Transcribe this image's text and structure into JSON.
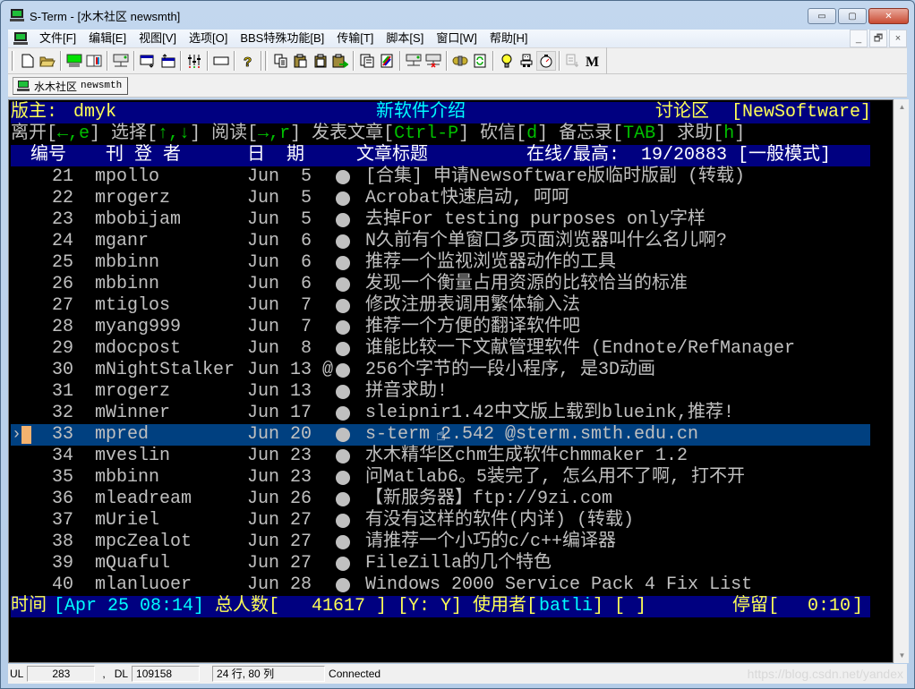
{
  "window": {
    "title": "S-Term - [水木社区 newsmth]",
    "controls": {
      "minimize": "▭",
      "maximize": "▢",
      "close": "✕"
    }
  },
  "menu": {
    "items": [
      "文件[F]",
      "编辑[E]",
      "视图[V]",
      "选项[O]",
      "BBS特殊功能[B]",
      "传输[T]",
      "脚本[S]",
      "窗口[W]",
      "帮助[H]"
    ],
    "mdi_controls": {
      "minimize": "_",
      "restore": "🗗",
      "close": "×"
    }
  },
  "toolbar": {
    "buttons": [
      {
        "name": "new-icon",
        "glyph": "🗋"
      },
      {
        "name": "open-folder-icon",
        "glyph": "📂"
      },
      {
        "name": "connect-terminal-icon",
        "glyph": "🖥"
      },
      {
        "name": "address-book-icon",
        "glyph": "📖"
      },
      {
        "name": "network-icon",
        "glyph": "🖧"
      },
      {
        "name": "window-send-icon",
        "glyph": "⧉"
      },
      {
        "name": "window-receive-icon",
        "glyph": "⧈"
      },
      {
        "name": "equalizer-icon",
        "glyph": "🎚"
      },
      {
        "name": "fullscreen-icon",
        "glyph": "▭"
      },
      {
        "name": "help-icon",
        "glyph": "?"
      },
      {
        "name": "copy-icon",
        "glyph": "⎘"
      },
      {
        "name": "paste-icon",
        "glyph": "📋"
      },
      {
        "name": "clipboard-icon",
        "glyph": "📋"
      },
      {
        "name": "paste-send-icon",
        "glyph": "📋"
      },
      {
        "name": "copy-document-icon",
        "glyph": "🗐"
      },
      {
        "name": "color-icon",
        "glyph": "🎨"
      },
      {
        "name": "connect-icon",
        "glyph": "🖧"
      },
      {
        "name": "disconnect-icon",
        "glyph": "🖧"
      },
      {
        "name": "plugin-icon",
        "glyph": "✿"
      },
      {
        "name": "refresh-icon",
        "glyph": "♻"
      },
      {
        "name": "tip-bulb-icon",
        "glyph": "💡"
      },
      {
        "name": "robot-icon",
        "glyph": "🤖"
      },
      {
        "name": "timer-icon",
        "glyph": "⏱"
      },
      {
        "name": "copy-disabled-icon",
        "glyph": "⎘"
      },
      {
        "name": "macro-icon",
        "glyph": "M"
      }
    ]
  },
  "tab": {
    "label": "水木社区",
    "host": "newsmth"
  },
  "terminal": {
    "header": {
      "moderator_label": "版主: ",
      "moderator": "dmyk",
      "board_title": "新软件介绍",
      "zone_label": "讨论区 ",
      "board_name": "[NewSoftware]"
    },
    "help_line": [
      {
        "t": "离开",
        "c": "grey"
      },
      {
        "t": "[",
        "c": "grey"
      },
      {
        "t": "←,e",
        "c": "green"
      },
      {
        "t": "] 选择[",
        "c": "grey"
      },
      {
        "t": "↑,↓",
        "c": "green"
      },
      {
        "t": "] 阅读[",
        "c": "grey"
      },
      {
        "t": "→,r",
        "c": "green"
      },
      {
        "t": "] 发表文章[",
        "c": "grey"
      },
      {
        "t": "Ctrl-P",
        "c": "green"
      },
      {
        "t": "] 砍信[",
        "c": "grey"
      },
      {
        "t": "d",
        "c": "green"
      },
      {
        "t": "] 备忘录[",
        "c": "grey"
      },
      {
        "t": "TAB",
        "c": "green"
      },
      {
        "t": "] 求助[",
        "c": "grey"
      },
      {
        "t": "h",
        "c": "green"
      },
      {
        "t": "]",
        "c": "grey"
      }
    ],
    "columns": {
      "num": "编号",
      "author": "刊 登 者",
      "date": "日  期",
      "title": "文章标题",
      "online": "在线/最高:  19/20883 [一般模式]"
    },
    "rows": [
      {
        "num": "21",
        "flag": "m",
        "author": "pollo",
        "month": "Jun",
        "day": "5",
        "mark": "",
        "title": "[合集] 申请Newsoftware版临时版副 (转载)"
      },
      {
        "num": "22",
        "flag": "m",
        "author": "rogerz",
        "month": "Jun",
        "day": "5",
        "mark": "",
        "title": "Acrobat快速启动, 呵呵"
      },
      {
        "num": "23",
        "flag": "m",
        "author": "bobijam",
        "month": "Jun",
        "day": "5",
        "mark": "",
        "title": "去掉For testing purposes only字样"
      },
      {
        "num": "24",
        "flag": "m",
        "author": "ganr",
        "month": "Jun",
        "day": "6",
        "mark": "",
        "title": "N久前有个单窗口多页面浏览器叫什么名儿啊?"
      },
      {
        "num": "25",
        "flag": "m",
        "author": "bbinn",
        "month": "Jun",
        "day": "6",
        "mark": "",
        "title": "推荐一个监视浏览器动作的工具"
      },
      {
        "num": "26",
        "flag": "m",
        "author": "bbinn",
        "month": "Jun",
        "day": "6",
        "mark": "",
        "title": "发现一个衡量占用资源的比较恰当的标准"
      },
      {
        "num": "27",
        "flag": "m",
        "author": "tiglos",
        "month": "Jun",
        "day": "7",
        "mark": "",
        "title": "修改注册表调用繁体输入法"
      },
      {
        "num": "28",
        "flag": "m",
        "author": "yang999",
        "month": "Jun",
        "day": "7",
        "mark": "",
        "title": "推荐一个方便的翻译软件吧"
      },
      {
        "num": "29",
        "flag": "m",
        "author": "docpost",
        "month": "Jun",
        "day": "8",
        "mark": "",
        "title": "谁能比较一下文献管理软件 (Endnote/RefManager"
      },
      {
        "num": "30",
        "flag": "m",
        "author": "NightStalker",
        "month": "Jun",
        "day": "13",
        "mark": "@",
        "title": "256个字节的一段小程序, 是3D动画"
      },
      {
        "num": "31",
        "flag": "m",
        "author": "rogerz",
        "month": "Jun",
        "day": "13",
        "mark": "",
        "title": "拼音求助!"
      },
      {
        "num": "32",
        "flag": "m",
        "author": "Winner",
        "month": "Jun",
        "day": "17",
        "mark": "",
        "title": "sleipnir1.42中文版上载到blueink,推荐!"
      },
      {
        "num": "33",
        "flag": "m",
        "author": "pred",
        "month": "Jun",
        "day": "20",
        "mark": "",
        "title": "s-term 2.542 @sterm.smth.edu.cn",
        "selected": true
      },
      {
        "num": "34",
        "flag": "m",
        "author": "veslin",
        "month": "Jun",
        "day": "23",
        "mark": "",
        "title": "水木精华区chm生成软件chmmaker 1.2"
      },
      {
        "num": "35",
        "flag": "m",
        "author": "bbinn",
        "month": "Jun",
        "day": "23",
        "mark": "",
        "title": "问Matlab6。5装完了, 怎么用不了啊, 打不开"
      },
      {
        "num": "36",
        "flag": "m",
        "author": "leadream",
        "month": "Jun",
        "day": "26",
        "mark": "",
        "title": "【新服务器】ftp://9zi.com"
      },
      {
        "num": "37",
        "flag": "m",
        "author": "Uriel",
        "month": "Jun",
        "day": "27",
        "mark": "",
        "title": "有没有这样的软件(内详) (转载)"
      },
      {
        "num": "38",
        "flag": "m",
        "author": "pcZealot",
        "month": "Jun",
        "day": "27",
        "mark": "",
        "title": "请推荐一个小巧的c/c++编译器"
      },
      {
        "num": "39",
        "flag": "m",
        "author": "Quaful",
        "month": "Jun",
        "day": "27",
        "mark": "",
        "title": "FileZilla的几个特色"
      },
      {
        "num": "40",
        "flag": "m",
        "author": "lanluoer",
        "month": "Jun",
        "day": "28",
        "mark": "",
        "title": "Windows 2000 Service Pack 4 Fix List"
      }
    ],
    "footer": {
      "time_label": "时间",
      "time_value": "[Apr 25 08:14]",
      "total_label": " 总人数[",
      "total_value": " 41617 ",
      "total_close": "] [Y: Y] 使用者[",
      "user": "batli",
      "user_close": "] [ ]",
      "idle_label": "停留[",
      "idle_value": "  0:10",
      "idle_close": "]"
    }
  },
  "statusbar": {
    "ul_label": "UL",
    "ul_value": "283",
    "sep": ",",
    "dl_label": "DL",
    "dl_value": "109158",
    "size": "24 行, 80 列",
    "status": "Connected",
    "watermark": "https://blog.csdn.net/yandex"
  },
  "colors": {
    "terminal_bg": "#000000",
    "header_bg": "#000080",
    "selected_row_bg": "#004080",
    "cursor_marker": "#f4b26f",
    "yellow": "#ffff55",
    "cyan": "#00ffff",
    "green": "#00c000",
    "grey": "#c0c0c0"
  }
}
